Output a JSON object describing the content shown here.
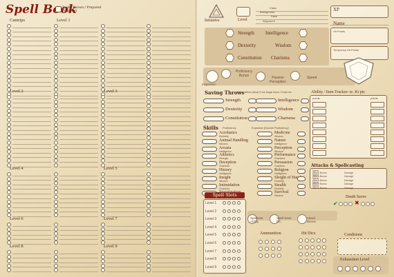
{
  "spellbook": {
    "title": "Spell Book",
    "legend_line1": "Spells Known / Prepared",
    "legend_line2": "Prepared",
    "headings": {
      "cantrips": "Cantrips",
      "level1": "Level 1",
      "level2": "Level 2",
      "level3": "Level 3",
      "level4": "Level 4",
      "level5": "Level 5",
      "level6": "Level 6",
      "level7": "Level 7",
      "level8": "Level 8",
      "level9": "Level 9"
    }
  },
  "sheet": {
    "initiative": "Initiative",
    "level": "Level",
    "class_label": "Class",
    "background_label": "Background",
    "race_label": "Race",
    "alignment_label": "Alignment",
    "xp": "XP",
    "name": "Name",
    "hit_points": "Hit Points",
    "temp_hit_points": "Temporary Hit Points",
    "abilities": [
      "Strength",
      "Intelligence",
      "Dexterity",
      "Wisdom",
      "Constitution",
      "Charisma"
    ],
    "inspiration": "Inspiration",
    "proficiency_bonus": "Proficiency Bonus",
    "passive_perception": "Passive Perception",
    "speed": "Speed",
    "saving_throws": "Saving Throws",
    "saving_note": "Add modifiers (Mod) From Magic Items / Feats etc.",
    "skills_title": "Skills",
    "proficiency": "Proficiency",
    "expertise": "Expertise (Double Proficiency)",
    "skills": [
      {
        "name": "Acrobatics",
        "ability": "Dexterity"
      },
      {
        "name": "Animal Handling",
        "ability": "Wisdom"
      },
      {
        "name": "Arcana",
        "ability": "Intelligence"
      },
      {
        "name": "Athletics",
        "ability": "Strength"
      },
      {
        "name": "Deception",
        "ability": "Charisma"
      },
      {
        "name": "History",
        "ability": "Intelligence"
      },
      {
        "name": "Insight",
        "ability": "Wisdom"
      },
      {
        "name": "Intimidation",
        "ability": "Charisma"
      },
      {
        "name": "Investigation",
        "ability": "Intelligence"
      },
      {
        "name": "Medicine",
        "ability": "Wisdom"
      },
      {
        "name": "Nature",
        "ability": "Intelligence"
      },
      {
        "name": "Perception",
        "ability": "Wisdom"
      },
      {
        "name": "Performance",
        "ability": "Charisma"
      },
      {
        "name": "Persuasion",
        "ability": "Charisma"
      },
      {
        "name": "Religion",
        "ability": "Intelligence"
      },
      {
        "name": "Sleight of Hand",
        "ability": "Dexterity"
      },
      {
        "name": "Stealth",
        "ability": "Dexterity"
      },
      {
        "name": "Survival",
        "ability": "Wisdom"
      }
    ],
    "ability_tracker": "Ability / Item Tracker- ie. Ki pts",
    "tracker_col1": "points",
    "tracker_col2": "points",
    "attacks_title": "Attacks & Spellcasting",
    "attack_rows": [
      {
        "name": "Name",
        "bonus": "Attack Bonus",
        "damage": "Damage"
      },
      {
        "name": "Name",
        "bonus": "Attack Bonus",
        "damage": "Damage"
      },
      {
        "name": "Name",
        "bonus": "Attack Bonus",
        "damage": "Damage"
      },
      {
        "name": "Name",
        "bonus": "Attack Bonus",
        "damage": "Damage"
      },
      {
        "name": "Name",
        "bonus": "Attack Bonus",
        "damage": "Damage"
      }
    ],
    "spell_slots": "Spell Slots",
    "slot_levels": [
      "Level 1",
      "Level 2",
      "Level 3",
      "Level 4",
      "Level 5",
      "Level 6",
      "Level 7",
      "Level 8",
      "Level 9"
    ],
    "spellcast_ability": "Spellcast Ability",
    "spell_save_dc": "Spell Save DC",
    "attack_bonus": "Attack Bonus",
    "death_saves": "Death Saves",
    "ammunition": "Ammunition",
    "hit_dice": "Hit Dice",
    "conditions": "Conditions",
    "exhaustion_level": "Exhaustion Level"
  }
}
